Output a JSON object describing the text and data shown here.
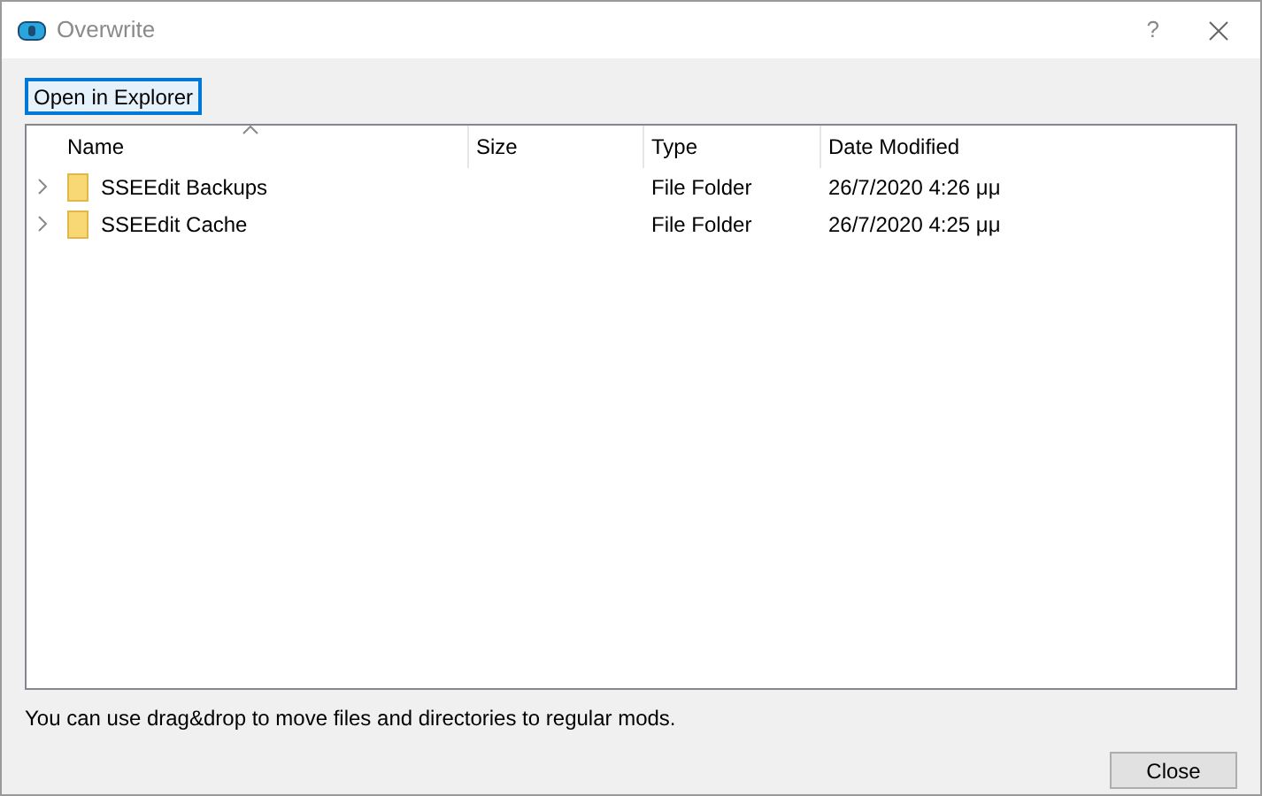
{
  "window": {
    "title": "Overwrite",
    "help": "?"
  },
  "toolbar": {
    "button": "Open in Explorer"
  },
  "tree": {
    "columns": [
      "Name",
      "Size",
      "Type",
      "Date Modified"
    ],
    "rows": [
      {
        "name": "SSEEdit Backups",
        "size": "",
        "type": "File Folder",
        "date": "26/7/2020 4:26 μμ",
        "expanded": false
      },
      {
        "name": "SSEEdit Cache",
        "size": "",
        "type": "File Folder",
        "date": "26/7/2020 4:25 μμ",
        "expanded": false
      }
    ]
  },
  "hint": "You can use drag&drop to move files and directories to regular mods.",
  "buttons": [
    "Close"
  ]
}
